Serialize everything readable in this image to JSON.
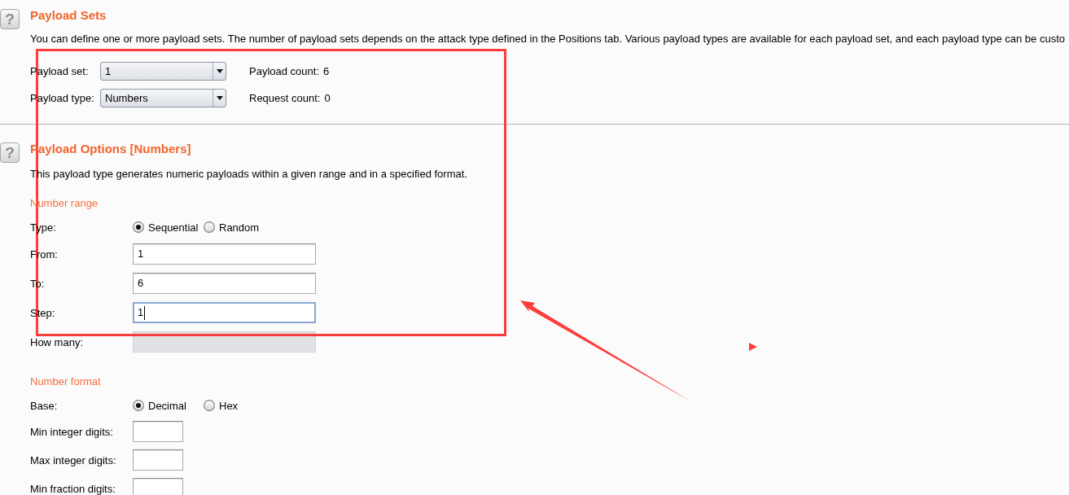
{
  "payload_sets": {
    "help_label": "?",
    "title": "Payload Sets",
    "description": "You can define one or more payload sets. The number of payload sets depends on the attack type defined in the Positions tab. Various payload types are available for each payload set, and each payload type can be custo",
    "selectors": [
      {
        "label": "Payload set:",
        "value": "1",
        "count_label": "Payload count:",
        "count": "6"
      },
      {
        "label": "Payload type:",
        "value": "Numbers",
        "count_label": "Request count:",
        "count": "0"
      }
    ]
  },
  "payload_options": {
    "help_label": "?",
    "title": "Payload Options [Numbers]",
    "description": "This payload type generates numeric payloads within a given range and in a specified format.",
    "groups": [
      {
        "heading": "Number range",
        "rows": [
          {
            "kind": "radio",
            "label": "Type:",
            "options": [
              {
                "label": "Sequential",
                "selected": true
              },
              {
                "label": "Random",
                "selected": false
              }
            ]
          },
          {
            "kind": "field",
            "label": "From:",
            "value": "1",
            "focused": false,
            "disabled": false
          },
          {
            "kind": "field",
            "label": "To:",
            "value": "6",
            "focused": false,
            "disabled": false
          },
          {
            "kind": "field",
            "label": "Step:",
            "value": "1",
            "focused": true,
            "disabled": false
          },
          {
            "kind": "field",
            "label": "How many:",
            "focused": false,
            "disabled": true
          }
        ]
      },
      {
        "heading": "Number format",
        "rows": [
          {
            "kind": "radio",
            "label": "Base:",
            "options": [
              {
                "label": "Decimal",
                "selected": true
              },
              {
                "label": "Hex",
                "selected": false
              }
            ]
          },
          {
            "kind": "short_field",
            "label": "Min integer digits:",
            "focused": false,
            "disabled": false
          },
          {
            "kind": "short_field",
            "label": "Max integer digits:",
            "focused": false,
            "disabled": false
          },
          {
            "kind": "short_field",
            "label": "Min fraction digits:",
            "focused": false,
            "disabled": false
          }
        ]
      }
    ]
  },
  "annotations": [
    {
      "kind": "box"
    },
    {
      "kind": "arrow"
    },
    {
      "kind": "marker"
    }
  ]
}
